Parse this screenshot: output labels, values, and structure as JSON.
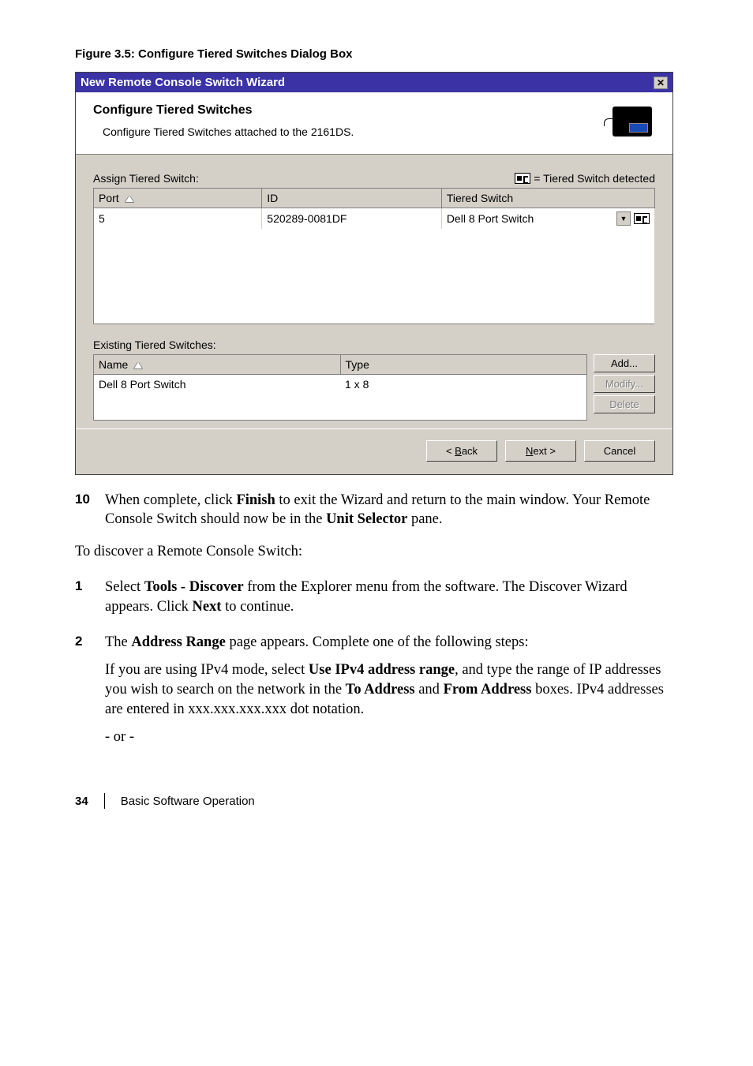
{
  "figure_caption": "Figure 3.5: Configure Tiered Switches Dialog Box",
  "dialog": {
    "title": "New Remote Console Switch Wizard",
    "header_title": "Configure Tiered Switches",
    "header_sub": "Configure Tiered Switches attached to the 2161DS.",
    "assign_label": "Assign Tiered Switch:",
    "legend_text": " = Tiered Switch detected",
    "assign_headers": {
      "port": "Port",
      "id": "ID",
      "tiered": "Tiered Switch"
    },
    "assign_row": {
      "port": "5",
      "id": "520289-0081DF",
      "tiered": "Dell 8 Port Switch"
    },
    "existing_label": "Existing Tiered Switches:",
    "existing_headers": {
      "name": "Name",
      "type": "Type"
    },
    "existing_row": {
      "name": "Dell 8 Port Switch",
      "type": "1 x 8"
    },
    "buttons": {
      "add": "Add...",
      "modify": "Modify...",
      "delete": "Delete",
      "back_prefix": "< ",
      "back_key": "B",
      "back_rest": "ack",
      "next_key": "N",
      "next_rest": "ext >",
      "cancel": "Cancel"
    }
  },
  "doc": {
    "step10_num": "10",
    "step10": "When complete, click Finish to exit the Wizard and return to the main window. Your Remote Console Switch should now be in the Unit Selector pane.",
    "discover_intro": "To discover a Remote Console Switch:",
    "step1_num": "1",
    "step1": "Select Tools - Discover from the Explorer menu from the software. The Discover Wizard appears. Click Next to continue.",
    "step2_num": "2",
    "step2a": "The Address Range page appears. Complete one of the following steps:",
    "step2b": "If you are using IPv4 mode, select Use IPv4 address range, and type the range of IP addresses you wish to search on the network in the To Address and From Address boxes. IPv4 addresses are entered in xxx.xxx.xxx.xxx dot notation.",
    "step2c": "- or -",
    "page_num": "34",
    "section": "Basic Software Operation"
  }
}
